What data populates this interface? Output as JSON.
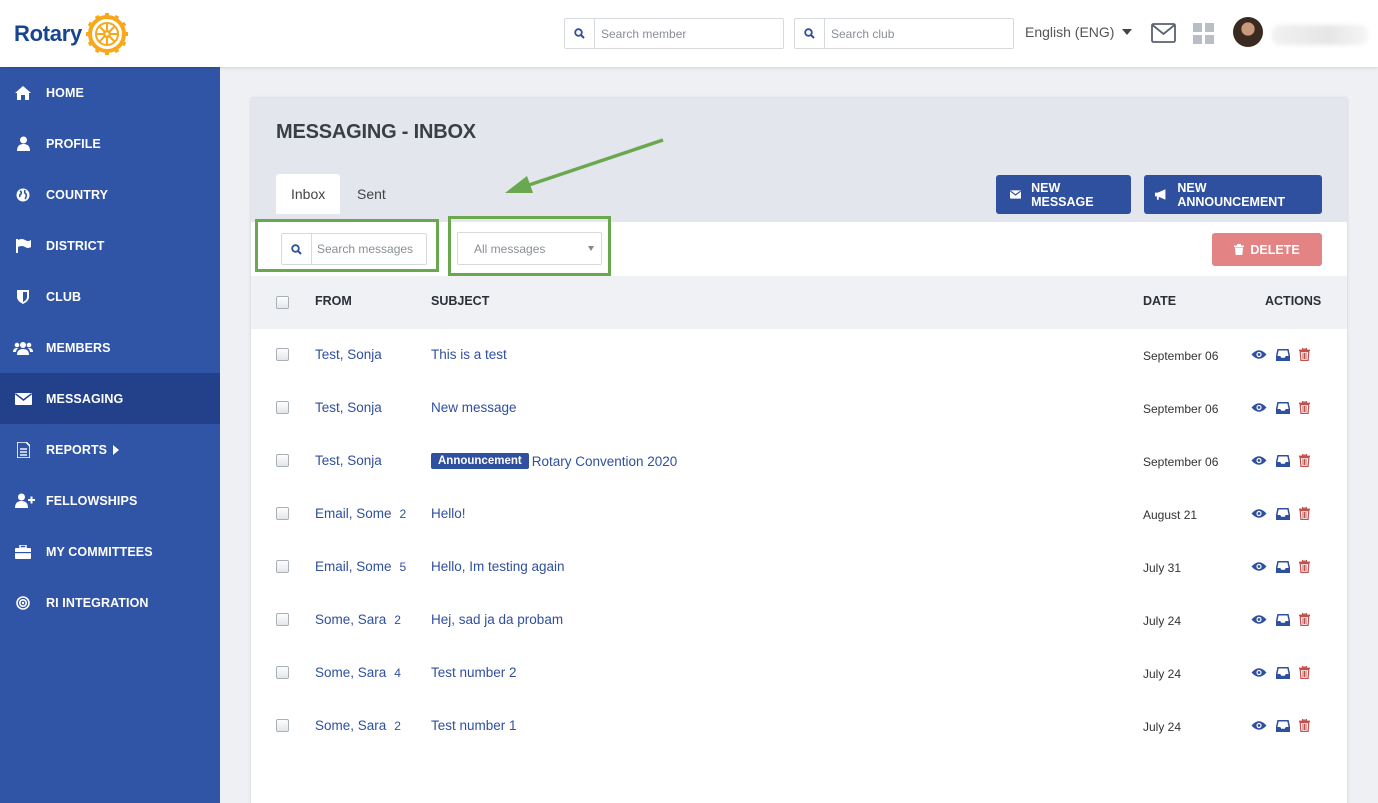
{
  "header": {
    "logo_text": "Rotary",
    "search_member_placeholder": "Search member",
    "search_club_placeholder": "Search club",
    "language": "English (ENG)"
  },
  "sidebar": {
    "items": [
      {
        "label": "HOME",
        "icon": "home-icon"
      },
      {
        "label": "PROFILE",
        "icon": "user-icon"
      },
      {
        "label": "COUNTRY",
        "icon": "globe-icon"
      },
      {
        "label": "DISTRICT",
        "icon": "flag-icon"
      },
      {
        "label": "CLUB",
        "icon": "shield-icon"
      },
      {
        "label": "MEMBERS",
        "icon": "users-icon"
      },
      {
        "label": "MESSAGING",
        "icon": "envelope-icon",
        "active": true
      },
      {
        "label": "REPORTS",
        "icon": "document-icon"
      },
      {
        "label": "FELLOWSHIPS",
        "icon": "user-plus-icon"
      },
      {
        "label": "MY COMMITTEES",
        "icon": "briefcase-icon"
      },
      {
        "label": "RI INTEGRATION",
        "icon": "target-icon"
      }
    ]
  },
  "page": {
    "title": "MESSAGING - INBOX",
    "tabs": [
      {
        "label": "Inbox",
        "active": true
      },
      {
        "label": "Sent",
        "active": false
      }
    ],
    "new_message_label": "NEW MESSAGE",
    "new_announcement_label": "NEW ANNOUNCEMENT",
    "search_messages_placeholder": "Search messages",
    "filter_selected": "All messages",
    "delete_label": "DELETE"
  },
  "table": {
    "columns": {
      "from": "FROM",
      "subject": "SUBJECT",
      "date": "DATE",
      "actions": "ACTIONS"
    },
    "rows": [
      {
        "from": "Test, Sonja",
        "count": "",
        "badge": "",
        "subject": "This is a test",
        "date": "September 06"
      },
      {
        "from": "Test, Sonja",
        "count": "",
        "badge": "",
        "subject": "New message",
        "date": "September 06"
      },
      {
        "from": "Test, Sonja",
        "count": "",
        "badge": "Announcement",
        "subject": "Rotary Convention 2020",
        "date": "September 06"
      },
      {
        "from": "Email, Some",
        "count": "2",
        "badge": "",
        "subject": "Hello!",
        "date": "August 21"
      },
      {
        "from": "Email, Some",
        "count": "5",
        "badge": "",
        "subject": "Hello, Im testing again",
        "date": "July 31"
      },
      {
        "from": "Some, Sara",
        "count": "2",
        "badge": "",
        "subject": "Hej, sad ja da probam",
        "date": "July 24"
      },
      {
        "from": "Some, Sara",
        "count": "4",
        "badge": "",
        "subject": "Test number 2",
        "date": "July 24"
      },
      {
        "from": "Some, Sara",
        "count": "2",
        "badge": "",
        "subject": "Test number 1",
        "date": "July 24"
      }
    ]
  },
  "colors": {
    "sidebar": "#3155a6",
    "sidebar_active": "#23418a",
    "primary": "#2f4f9f",
    "delete": "#e48383",
    "highlight": "#6aa84f",
    "trash_icon": "#c0504d"
  }
}
